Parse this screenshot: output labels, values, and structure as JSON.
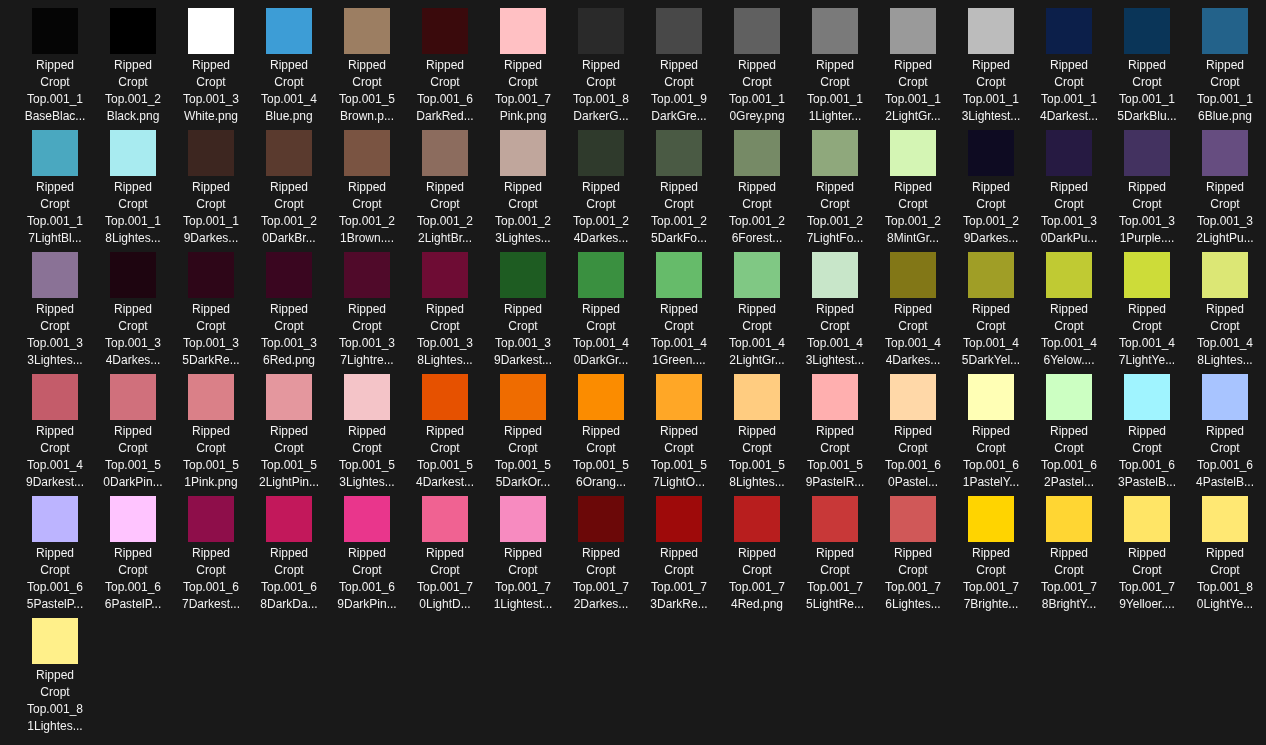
{
  "files": [
    {
      "lines": [
        "Ripped",
        "Cropt",
        "Top.001_1",
        "BaseBlac..."
      ],
      "color": "#050505"
    },
    {
      "lines": [
        "Ripped",
        "Cropt",
        "Top.001_2",
        "Black.png"
      ],
      "color": "#000000"
    },
    {
      "lines": [
        "Ripped",
        "Cropt",
        "Top.001_3",
        "White.png"
      ],
      "color": "#ffffff"
    },
    {
      "lines": [
        "Ripped",
        "Cropt",
        "Top.001_4",
        "Blue.png"
      ],
      "color": "#3d9dd6"
    },
    {
      "lines": [
        "Ripped",
        "Cropt",
        "Top.001_5",
        "Brown.p..."
      ],
      "color": "#9c7e62"
    },
    {
      "lines": [
        "Ripped",
        "Cropt",
        "Top.001_6",
        "DarkRed..."
      ],
      "color": "#3a0a0c"
    },
    {
      "lines": [
        "Ripped",
        "Cropt",
        "Top.001_7",
        "Pink.png"
      ],
      "color": "#ffc0c3"
    },
    {
      "lines": [
        "Ripped",
        "Cropt",
        "Top.001_8",
        "DarkerG..."
      ],
      "color": "#2a2a2a"
    },
    {
      "lines": [
        "Ripped",
        "Cropt",
        "Top.001_9",
        "DarkGre..."
      ],
      "color": "#484848"
    },
    {
      "lines": [
        "Ripped",
        "Cropt",
        "Top.001_1",
        "0Grey.png"
      ],
      "color": "#606060"
    },
    {
      "lines": [
        "Ripped",
        "Cropt",
        "Top.001_1",
        "1Lighter..."
      ],
      "color": "#7a7a7a"
    },
    {
      "lines": [
        "Ripped",
        "Cropt",
        "Top.001_1",
        "2LightGr..."
      ],
      "color": "#9a9a9a"
    },
    {
      "lines": [
        "Ripped",
        "Cropt",
        "Top.001_1",
        "3Lightest..."
      ],
      "color": "#bcbcbc"
    },
    {
      "lines": [
        "Ripped",
        "Cropt",
        "Top.001_1",
        "4Darkest..."
      ],
      "color": "#0c1f4a"
    },
    {
      "lines": [
        "Ripped",
        "Cropt",
        "Top.001_1",
        "5DarkBlu..."
      ],
      "color": "#0a3558"
    },
    {
      "lines": [
        "Ripped",
        "Cropt",
        "Top.001_1",
        "6Blue.png"
      ],
      "color": "#23628a"
    },
    {
      "lines": [
        "Ripped",
        "Cropt",
        "Top.001_1",
        "7LightBl..."
      ],
      "color": "#4aa8c0"
    },
    {
      "lines": [
        "Ripped",
        "Cropt",
        "Top.001_1",
        "8Lightes..."
      ],
      "color": "#a8ebf0"
    },
    {
      "lines": [
        "Ripped",
        "Cropt",
        "Top.001_1",
        "9Darkes..."
      ],
      "color": "#3d2620"
    },
    {
      "lines": [
        "Ripped",
        "Cropt",
        "Top.001_2",
        "0DarkBr..."
      ],
      "color": "#5a3a2e"
    },
    {
      "lines": [
        "Ripped",
        "Cropt",
        "Top.001_2",
        "1Brown...."
      ],
      "color": "#7a5442"
    },
    {
      "lines": [
        "Ripped",
        "Cropt",
        "Top.001_2",
        "2LightBr..."
      ],
      "color": "#8c6c5e"
    },
    {
      "lines": [
        "Ripped",
        "Cropt",
        "Top.001_2",
        "3Lightes..."
      ],
      "color": "#c0a69c"
    },
    {
      "lines": [
        "Ripped",
        "Cropt",
        "Top.001_2",
        "4Darkes..."
      ],
      "color": "#2f3a2c"
    },
    {
      "lines": [
        "Ripped",
        "Cropt",
        "Top.001_2",
        "5DarkFo..."
      ],
      "color": "#4a5a44"
    },
    {
      "lines": [
        "Ripped",
        "Cropt",
        "Top.001_2",
        "6Forest..."
      ],
      "color": "#768a66"
    },
    {
      "lines": [
        "Ripped",
        "Cropt",
        "Top.001_2",
        "7LightFo..."
      ],
      "color": "#8fa87c"
    },
    {
      "lines": [
        "Ripped",
        "Cropt",
        "Top.001_2",
        "8MintGr..."
      ],
      "color": "#d4f5b4"
    },
    {
      "lines": [
        "Ripped",
        "Cropt",
        "Top.001_2",
        "9Darkes..."
      ],
      "color": "#0e0b22"
    },
    {
      "lines": [
        "Ripped",
        "Cropt",
        "Top.001_3",
        "0DarkPu..."
      ],
      "color": "#261a42"
    },
    {
      "lines": [
        "Ripped",
        "Cropt",
        "Top.001_3",
        "1Purple...."
      ],
      "color": "#433260"
    },
    {
      "lines": [
        "Ripped",
        "Cropt",
        "Top.001_3",
        "2LightPu..."
      ],
      "color": "#664d80"
    },
    {
      "lines": [
        "Ripped",
        "Cropt",
        "Top.001_3",
        "3Lightes..."
      ],
      "color": "#8a7296"
    },
    {
      "lines": [
        "Ripped",
        "Cropt",
        "Top.001_3",
        "4Darkes..."
      ],
      "color": "#1e0510"
    },
    {
      "lines": [
        "Ripped",
        "Cropt",
        "Top.001_3",
        "5DarkRe..."
      ],
      "color": "#2e0618"
    },
    {
      "lines": [
        "Ripped",
        "Cropt",
        "Top.001_3",
        "6Red.png"
      ],
      "color": "#3a0620"
    },
    {
      "lines": [
        "Ripped",
        "Cropt",
        "Top.001_3",
        "7Lightre..."
      ],
      "color": "#500a2a"
    },
    {
      "lines": [
        "Ripped",
        "Cropt",
        "Top.001_3",
        "8Lightes..."
      ],
      "color": "#6e0c34"
    },
    {
      "lines": [
        "Ripped",
        "Cropt",
        "Top.001_3",
        "9Darkest..."
      ],
      "color": "#1e5c22"
    },
    {
      "lines": [
        "Ripped",
        "Cropt",
        "Top.001_4",
        "0DarkGr..."
      ],
      "color": "#3a9040"
    },
    {
      "lines": [
        "Ripped",
        "Cropt",
        "Top.001_4",
        "1Green...."
      ],
      "color": "#66bb6a"
    },
    {
      "lines": [
        "Ripped",
        "Cropt",
        "Top.001_4",
        "2LightGr..."
      ],
      "color": "#80c884"
    },
    {
      "lines": [
        "Ripped",
        "Cropt",
        "Top.001_4",
        "3Lightest..."
      ],
      "color": "#c8e6c9"
    },
    {
      "lines": [
        "Ripped",
        "Cropt",
        "Top.001_4",
        "4Darkes..."
      ],
      "color": "#827717"
    },
    {
      "lines": [
        "Ripped",
        "Cropt",
        "Top.001_4",
        "5DarkYel..."
      ],
      "color": "#a09e26"
    },
    {
      "lines": [
        "Ripped",
        "Cropt",
        "Top.001_4",
        "6Yelow...."
      ],
      "color": "#c0ca33"
    },
    {
      "lines": [
        "Ripped",
        "Cropt",
        "Top.001_4",
        "7LightYe..."
      ],
      "color": "#cddc39"
    },
    {
      "lines": [
        "Ripped",
        "Cropt",
        "Top.001_4",
        "8Lightes..."
      ],
      "color": "#dce775"
    },
    {
      "lines": [
        "Ripped",
        "Cropt",
        "Top.001_4",
        "9Darkest..."
      ],
      "color": "#c45c6a"
    },
    {
      "lines": [
        "Ripped",
        "Cropt",
        "Top.001_5",
        "0DarkPin..."
      ],
      "color": "#d0707c"
    },
    {
      "lines": [
        "Ripped",
        "Cropt",
        "Top.001_5",
        "1Pink.png"
      ],
      "color": "#da8088"
    },
    {
      "lines": [
        "Ripped",
        "Cropt",
        "Top.001_5",
        "2LightPin..."
      ],
      "color": "#e4979e"
    },
    {
      "lines": [
        "Ripped",
        "Cropt",
        "Top.001_5",
        "3Lightes..."
      ],
      "color": "#f4c4c8"
    },
    {
      "lines": [
        "Ripped",
        "Cropt",
        "Top.001_5",
        "4Darkest..."
      ],
      "color": "#e65100"
    },
    {
      "lines": [
        "Ripped",
        "Cropt",
        "Top.001_5",
        "5DarkOr..."
      ],
      "color": "#ef6c00"
    },
    {
      "lines": [
        "Ripped",
        "Cropt",
        "Top.001_5",
        "6Orang..."
      ],
      "color": "#fb8c00"
    },
    {
      "lines": [
        "Ripped",
        "Cropt",
        "Top.001_5",
        "7LightO..."
      ],
      "color": "#ffa726"
    },
    {
      "lines": [
        "Ripped",
        "Cropt",
        "Top.001_5",
        "8Lightes..."
      ],
      "color": "#ffcc80"
    },
    {
      "lines": [
        "Ripped",
        "Cropt",
        "Top.001_5",
        "9PastelR..."
      ],
      "color": "#ffafaf"
    },
    {
      "lines": [
        "Ripped",
        "Cropt",
        "Top.001_6",
        "0Pastel..."
      ],
      "color": "#ffd8a8"
    },
    {
      "lines": [
        "Ripped",
        "Cropt",
        "Top.001_6",
        "1PastelY..."
      ],
      "color": "#ffffb5"
    },
    {
      "lines": [
        "Ripped",
        "Cropt",
        "Top.001_6",
        "2Pastel..."
      ],
      "color": "#ccffc2"
    },
    {
      "lines": [
        "Ripped",
        "Cropt",
        "Top.001_6",
        "3PastelB..."
      ],
      "color": "#a0f4ff"
    },
    {
      "lines": [
        "Ripped",
        "Cropt",
        "Top.001_6",
        "4PastelB..."
      ],
      "color": "#a8c4ff"
    },
    {
      "lines": [
        "Ripped",
        "Cropt",
        "Top.001_6",
        "5PastelP..."
      ],
      "color": "#bcb4ff"
    },
    {
      "lines": [
        "Ripped",
        "Cropt",
        "Top.001_6",
        "6PastelP..."
      ],
      "color": "#ffc4ff"
    },
    {
      "lines": [
        "Ripped",
        "Cropt",
        "Top.001_6",
        "7Darkest..."
      ],
      "color": "#8e0e4a"
    },
    {
      "lines": [
        "Ripped",
        "Cropt",
        "Top.001_6",
        "8DarkDa..."
      ],
      "color": "#c2185b"
    },
    {
      "lines": [
        "Ripped",
        "Cropt",
        "Top.001_6",
        "9DarkPin..."
      ],
      "color": "#e9368c"
    },
    {
      "lines": [
        "Ripped",
        "Cropt",
        "Top.001_7",
        "0LightD..."
      ],
      "color": "#f06292"
    },
    {
      "lines": [
        "Ripped",
        "Cropt",
        "Top.001_7",
        "1Lightest..."
      ],
      "color": "#f78bc0"
    },
    {
      "lines": [
        "Ripped",
        "Cropt",
        "Top.001_7",
        "2Darkes..."
      ],
      "color": "#6b0808"
    },
    {
      "lines": [
        "Ripped",
        "Cropt",
        "Top.001_7",
        "3DarkRe..."
      ],
      "color": "#9e0a0a"
    },
    {
      "lines": [
        "Ripped",
        "Cropt",
        "Top.001_7",
        "4Red.png"
      ],
      "color": "#b81e1e"
    },
    {
      "lines": [
        "Ripped",
        "Cropt",
        "Top.001_7",
        "5LightRe..."
      ],
      "color": "#c83838"
    },
    {
      "lines": [
        "Ripped",
        "Cropt",
        "Top.001_7",
        "6Lightes..."
      ],
      "color": "#d05858"
    },
    {
      "lines": [
        "Ripped",
        "Cropt",
        "Top.001_7",
        "7Brighte..."
      ],
      "color": "#ffd400"
    },
    {
      "lines": [
        "Ripped",
        "Cropt",
        "Top.001_7",
        "8BrightY..."
      ],
      "color": "#ffd633"
    },
    {
      "lines": [
        "Ripped",
        "Cropt",
        "Top.001_7",
        "9Yelloer...."
      ],
      "color": "#ffe566"
    },
    {
      "lines": [
        "Ripped",
        "Cropt",
        "Top.001_8",
        "0LightYe..."
      ],
      "color": "#ffe873"
    },
    {
      "lines": [
        "Ripped",
        "Cropt",
        "Top.001_8",
        "1Lightes..."
      ],
      "color": "#fff08a"
    }
  ]
}
